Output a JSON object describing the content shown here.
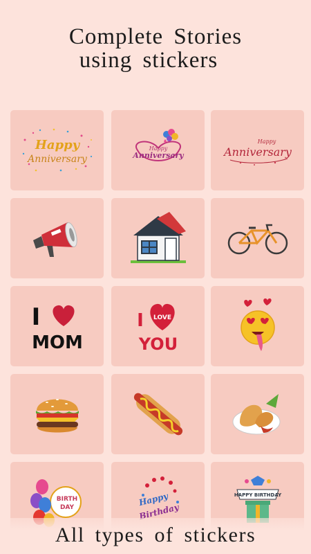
{
  "header": {
    "line1": "Complete  Stories",
    "line2": "using  stickers"
  },
  "stickers": [
    {
      "name": "Happy Anniversary confetti",
      "text1": "Happy",
      "text2": "Anniversary"
    },
    {
      "name": "Happy Anniversary balloons",
      "text1": "Happy",
      "text2": "Anniversary"
    },
    {
      "name": "Happy Anniversary script",
      "text1": "Happy",
      "text2": "Anniversary"
    },
    {
      "name": "megaphone"
    },
    {
      "name": "house"
    },
    {
      "name": "bicycle"
    },
    {
      "name": "I love mom",
      "text1": "I",
      "text2": "MOM"
    },
    {
      "name": "I love you",
      "text1": "I",
      "text2": "LOVE",
      "text3": "YOU"
    },
    {
      "name": "love emoji"
    },
    {
      "name": "burger"
    },
    {
      "name": "hot dog"
    },
    {
      "name": "samosa plate"
    },
    {
      "name": "birthday balloons",
      "text1": "BIRTH",
      "text2": "DAY"
    },
    {
      "name": "Happy Birthday hearts",
      "text1": "Happy",
      "text2": "Birthday"
    },
    {
      "name": "Happy Birthday gift",
      "text1": "HAPPY BIRTHDAY"
    }
  ],
  "footer": {
    "text": "All types of  stickers"
  },
  "colors": {
    "background": "#fde3dc",
    "tile": "#f7cbc1"
  }
}
